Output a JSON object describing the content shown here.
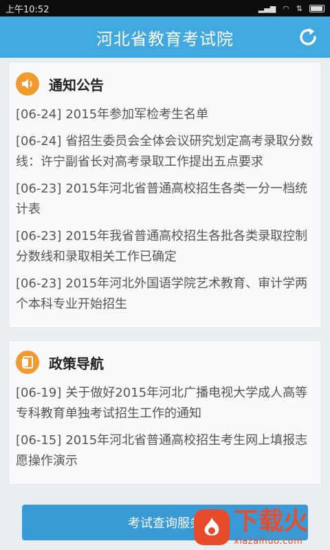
{
  "status_bar": {
    "time": "上午10:52"
  },
  "header": {
    "title": "河北省教育考试院"
  },
  "sections": [
    {
      "title": "通知公告",
      "icon": "speaker-icon",
      "items": [
        {
          "date": "[06-24]",
          "text": "2015年参加军检考生名单"
        },
        {
          "date": "[06-24]",
          "text": "省招生委员会全体会议研究划定高考录取分数线：许宁副省长对高考录取工作提出五点要求"
        },
        {
          "date": "[06-23]",
          "text": "2015年河北省普通高校招生各类一分一档统计表"
        },
        {
          "date": "[06-23]",
          "text": "2015年我省普通高校招生各批各类录取控制分数线和录取相关工作已确定"
        },
        {
          "date": "[06-23]",
          "text": "2015年河北外国语学院艺术教育、审计学两个本科专业开始招生"
        }
      ]
    },
    {
      "title": "政策导航",
      "icon": "document-icon",
      "items": [
        {
          "date": "[06-19]",
          "text": "关于做好2015年河北广播电视大学成人高等专科教育单独考试招生工作的通知"
        },
        {
          "date": "[06-15]",
          "text": "2015年河北省普通高校招生考生网上填报志愿操作演示"
        }
      ]
    }
  ],
  "bottom": {
    "query_button": "考试查询服务"
  },
  "watermark": {
    "cn": "下载火",
    "en": "xiazaihuo.com"
  },
  "colors": {
    "header_blue": "#41a9df",
    "button_blue": "#3a9ad6",
    "icon_orange": "#f29a2e",
    "watermark_red": "#e84b2c"
  }
}
